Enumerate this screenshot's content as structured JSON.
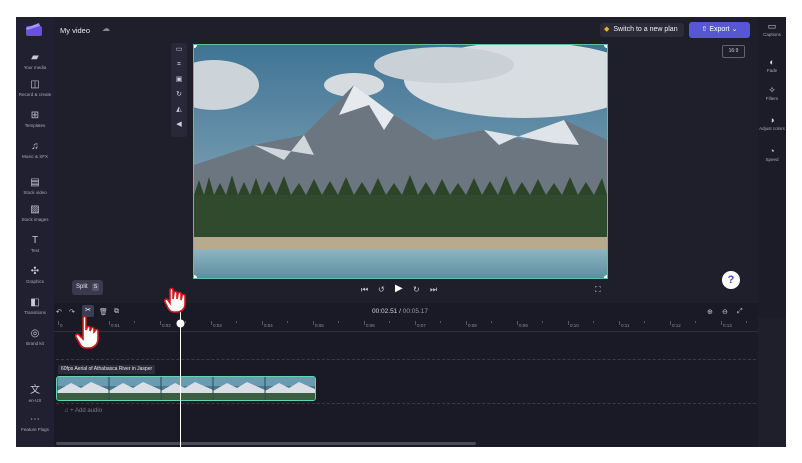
{
  "app": {
    "title": "My video"
  },
  "topbar": {
    "upgrade_label": "Switch to a new plan",
    "export_label": "Export",
    "ratio": "16:9"
  },
  "left_nav": [
    {
      "label": "Your media",
      "icon": "folder-icon"
    },
    {
      "label": "Record & create",
      "icon": "record-icon"
    },
    {
      "label": "Templates",
      "icon": "templates-icon"
    },
    {
      "label": "Music & SFX",
      "icon": "music-icon"
    },
    {
      "label": "Stock video",
      "icon": "film-icon"
    },
    {
      "label": "Stock images",
      "icon": "image-icon"
    },
    {
      "label": "Text",
      "icon": "text-icon"
    },
    {
      "label": "Graphics",
      "icon": "graphics-icon"
    },
    {
      "label": "Transitions",
      "icon": "transitions-icon"
    },
    {
      "label": "Brand kit",
      "icon": "brand-kit-icon"
    },
    {
      "label": "en-US",
      "icon": "language-icon"
    },
    {
      "label": "Feature Flags",
      "icon": "more-icon"
    }
  ],
  "right_nav": [
    {
      "label": "Captions",
      "icon": "captions-icon"
    },
    {
      "label": "Fade",
      "icon": "fade-icon"
    },
    {
      "label": "Filters",
      "icon": "filters-icon"
    },
    {
      "label": "Adjust colors",
      "icon": "adjust-colors-icon"
    },
    {
      "label": "Speed",
      "icon": "speed-icon"
    }
  ],
  "timeline": {
    "split_tooltip": "Split",
    "split_key": "S",
    "current_time": "00:02.51",
    "total_time": "00:05.17",
    "ruler": [
      "0",
      "0:01",
      "0:02",
      "0:03",
      "0:04",
      "0:05",
      "0:06",
      "0:07",
      "0:08",
      "0:09",
      "0:10",
      "0:11",
      "0:12",
      "0:13"
    ],
    "clip_label": "60fps Aerial of Athabasca River in Jasper",
    "audio_label": "+ Add audio"
  },
  "colors": {
    "accent": "#5757d6",
    "selection": "#55c39d",
    "upgrade_gem": "#f3b21b"
  }
}
